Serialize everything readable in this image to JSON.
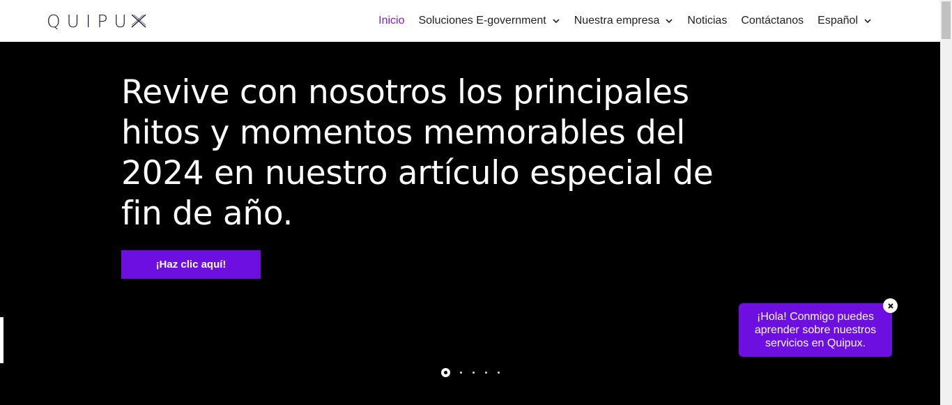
{
  "header": {
    "logo_text": "QUIPU",
    "nav": [
      {
        "label": "Inicio",
        "active": true,
        "dropdown": false
      },
      {
        "label": "Soluciones E-government",
        "active": false,
        "dropdown": true
      },
      {
        "label": "Nuestra empresa",
        "active": false,
        "dropdown": true
      },
      {
        "label": "Noticias",
        "active": false,
        "dropdown": false
      },
      {
        "label": "Contáctanos",
        "active": false,
        "dropdown": false
      },
      {
        "label": "Español",
        "active": false,
        "dropdown": true
      }
    ]
  },
  "hero": {
    "title": "Revive con nosotros los principales hitos y momentos memorables del 2024 en nuestro artículo especial de fin de año.",
    "cta_label": "¡Haz clic aquí!",
    "slides_total": 5,
    "slide_active": 1
  },
  "chat": {
    "message": "¡Hola! Conmigo puedes aprender sobre nuestros servicios en Quipux.",
    "close_icon": "close-icon"
  },
  "colors": {
    "accent": "#6c0fe0",
    "nav_active": "#7a1fd6",
    "hero_bg": "#000000",
    "header_bg": "#ffffff"
  }
}
